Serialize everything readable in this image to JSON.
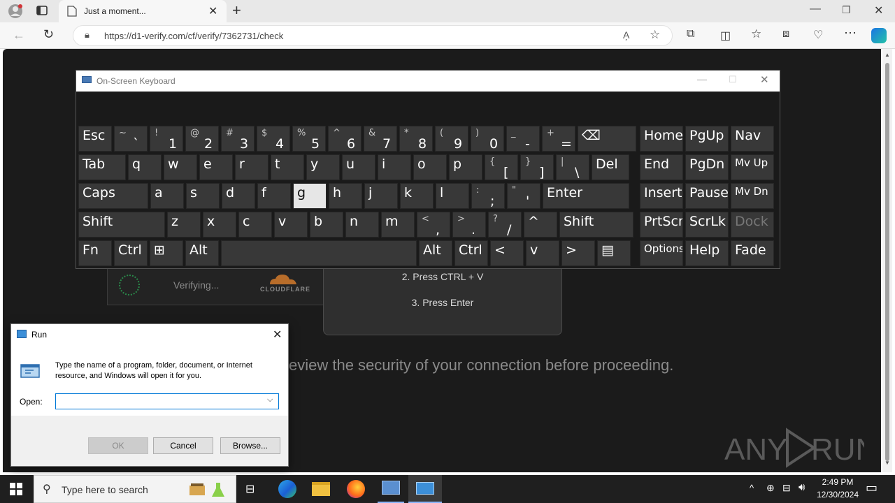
{
  "browser": {
    "tab_title": "Just a moment...",
    "new_tab": "+",
    "url": "https://d1-verify.com/cf/verify/7362731/check",
    "icons": [
      "profile-icon",
      "tab-actions-icon",
      "back-icon",
      "reload-icon",
      "lock-icon",
      "read-aloud-icon",
      "favorite-icon",
      "extensions-icon",
      "split-screen-icon",
      "favorites-icon",
      "collections-icon",
      "browser-essentials-icon",
      "more-icon",
      "copilot-icon"
    ]
  },
  "page": {
    "verifying_text": "Verifying...",
    "cloudflare_logo": "CLOUDFLARE",
    "step2": "2. Press CTRL + V",
    "step3": "3. Press Enter",
    "review_text": "eview the security of your connection before proceeding.",
    "watermark": "ANY RUN"
  },
  "osk": {
    "title": "On-Screen Keyboard",
    "highlight_key": "g",
    "rows": [
      [
        {
          "p": "Esc"
        },
        {
          "s": "~",
          "p": "`"
        },
        {
          "s": "!",
          "p": "1"
        },
        {
          "s": "@",
          "p": "2"
        },
        {
          "s": "#",
          "p": "3"
        },
        {
          "s": "$",
          "p": "4"
        },
        {
          "s": "%",
          "p": "5"
        },
        {
          "s": "^",
          "p": "6"
        },
        {
          "s": "&",
          "p": "7"
        },
        {
          "s": "*",
          "p": "8"
        },
        {
          "s": "(",
          "p": "9"
        },
        {
          "s": ")",
          "p": "0"
        },
        {
          "s": "_",
          "p": "-"
        },
        {
          "s": "+",
          "p": "="
        },
        {
          "p": "⌫"
        },
        {
          "p": "Home"
        },
        {
          "p": "PgUp"
        },
        {
          "p": "Nav"
        }
      ],
      [
        {
          "p": "Tab"
        },
        {
          "p": "q"
        },
        {
          "p": "w"
        },
        {
          "p": "e"
        },
        {
          "p": "r"
        },
        {
          "p": "t"
        },
        {
          "p": "y"
        },
        {
          "p": "u"
        },
        {
          "p": "i"
        },
        {
          "p": "o"
        },
        {
          "p": "p"
        },
        {
          "s": "{",
          "p": "["
        },
        {
          "s": "}",
          "p": "]"
        },
        {
          "s": "|",
          "p": "\\"
        },
        {
          "p": "Del"
        },
        {
          "p": "End"
        },
        {
          "p": "PgDn"
        },
        {
          "p": "Mv Up"
        }
      ],
      [
        {
          "p": "Caps"
        },
        {
          "p": "a"
        },
        {
          "p": "s"
        },
        {
          "p": "d"
        },
        {
          "p": "f"
        },
        {
          "p": "g"
        },
        {
          "p": "h"
        },
        {
          "p": "j"
        },
        {
          "p": "k"
        },
        {
          "p": "l"
        },
        {
          "s": ":",
          "p": ";"
        },
        {
          "s": "\"",
          "p": "'"
        },
        {
          "p": "Enter"
        },
        {
          "p": "Insert"
        },
        {
          "p": "Pause"
        },
        {
          "p": "Mv Dn"
        }
      ],
      [
        {
          "p": "Shift"
        },
        {
          "p": "z"
        },
        {
          "p": "x"
        },
        {
          "p": "c"
        },
        {
          "p": "v"
        },
        {
          "p": "b"
        },
        {
          "p": "n"
        },
        {
          "p": "m"
        },
        {
          "s": "<",
          "p": ","
        },
        {
          "s": ">",
          "p": "."
        },
        {
          "s": "?",
          "p": "/"
        },
        {
          "p": "^"
        },
        {
          "p": "Shift"
        },
        {
          "p": "PrtScn"
        },
        {
          "p": "ScrLk"
        },
        {
          "p": "Dock"
        }
      ],
      [
        {
          "p": "Fn"
        },
        {
          "p": "Ctrl"
        },
        {
          "p": "⊞"
        },
        {
          "p": "Alt"
        },
        {
          "p": ""
        },
        {
          "p": "Alt"
        },
        {
          "p": "Ctrl"
        },
        {
          "p": "<"
        },
        {
          "p": "v"
        },
        {
          "p": ">"
        },
        {
          "p": "▤"
        },
        {
          "p": "Options"
        },
        {
          "p": "Help"
        },
        {
          "p": "Fade"
        }
      ]
    ]
  },
  "run": {
    "title": "Run",
    "description": "Type the name of a program, folder, document, or Internet resource, and Windows will open it for you.",
    "open_label": "Open:",
    "open_value": "",
    "ok": "OK",
    "cancel": "Cancel",
    "browse": "Browse..."
  },
  "taskbar": {
    "search_placeholder": "Type here to search",
    "time": "2:49 PM",
    "date": "12/30/2024"
  }
}
